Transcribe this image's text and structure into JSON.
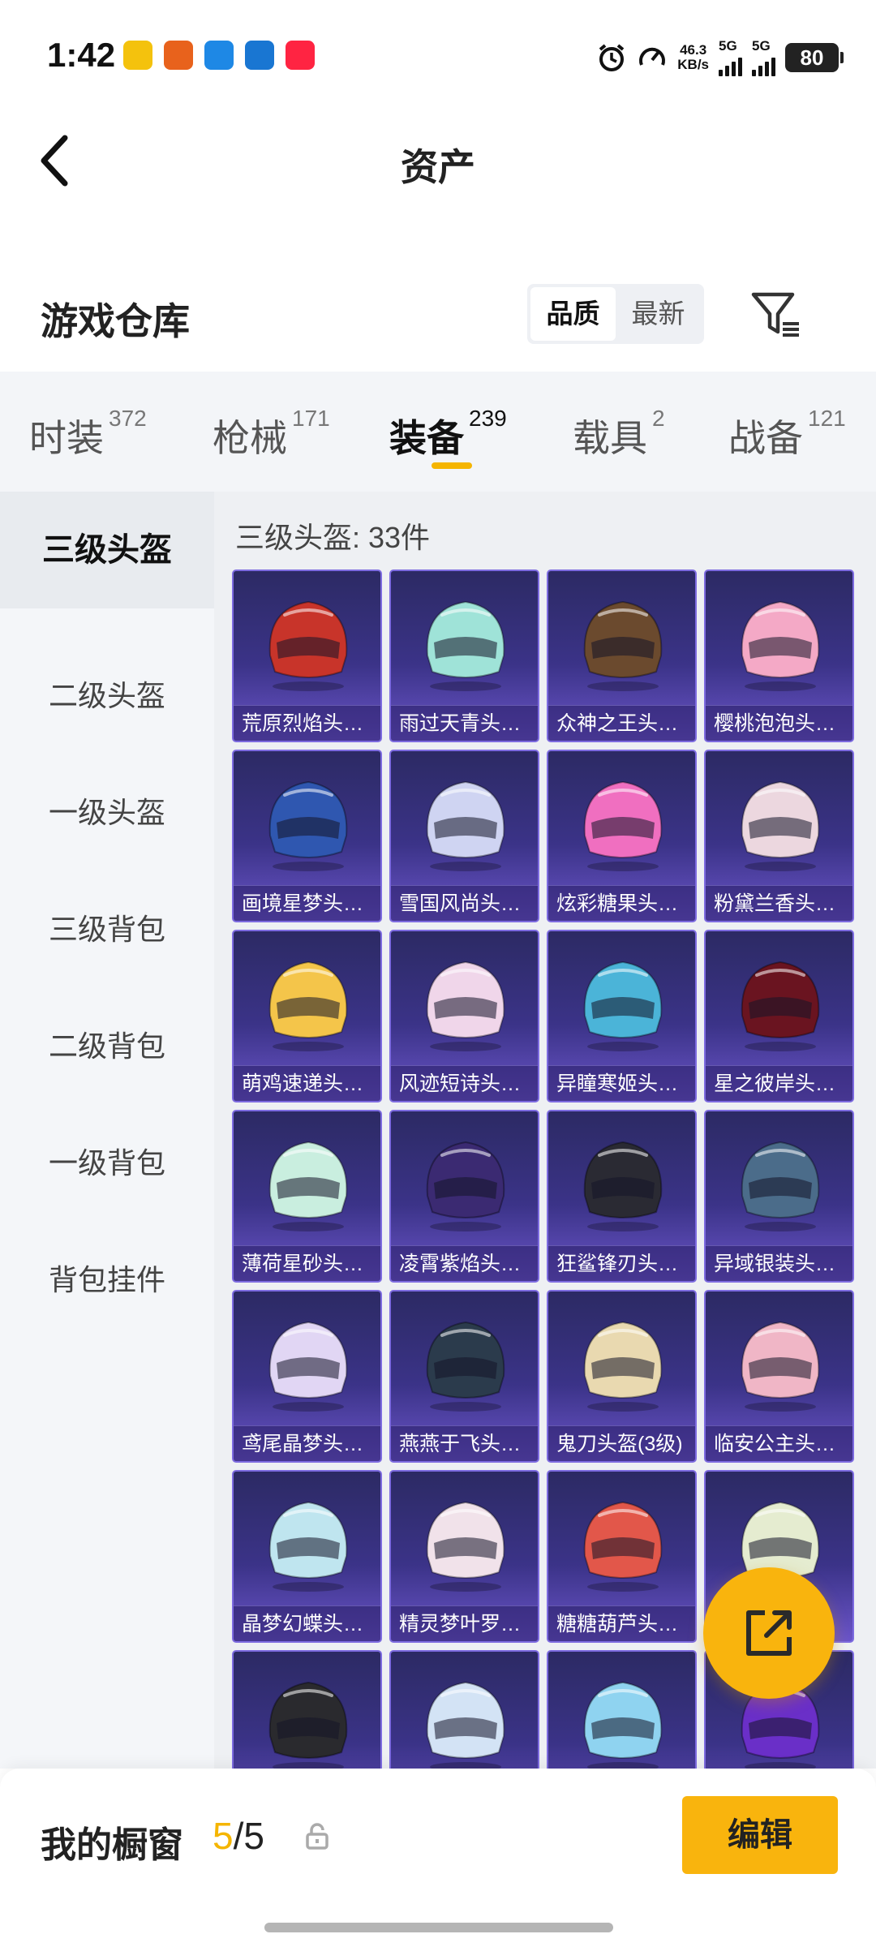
{
  "status_bar": {
    "time": "1:42",
    "net_speed_value": "46.3",
    "net_speed_unit": "KB/s",
    "network_1": "5G",
    "network_2": "5G",
    "battery": "80",
    "app_icons": [
      {
        "icon": "rabbit-app-icon",
        "color": "#f4c20d"
      },
      {
        "icon": "pumpkin-app-icon",
        "color": "#e8621c"
      },
      {
        "icon": "browser-app-icon",
        "color": "#1e88e5"
      },
      {
        "icon": "message-app-icon",
        "color": "#1976d2"
      },
      {
        "icon": "xiaohongshu-app-icon",
        "color": "#ff2442"
      }
    ]
  },
  "header": {
    "title": "资产"
  },
  "warehouse": {
    "title": "游戏仓库",
    "sort_options": [
      "品质",
      "最新"
    ],
    "active_sort": "品质"
  },
  "tabs": [
    {
      "label": "时装",
      "count": "372"
    },
    {
      "label": "枪械",
      "count": "171"
    },
    {
      "label": "装备",
      "count": "239"
    },
    {
      "label": "载具",
      "count": "2"
    },
    {
      "label": "战备",
      "count": "121"
    }
  ],
  "active_tab": "装备",
  "sidebar": {
    "items": [
      "三级头盔",
      "二级头盔",
      "一级头盔",
      "三级背包",
      "二级背包",
      "一级背包",
      "背包挂件"
    ],
    "active": "三级头盔"
  },
  "content": {
    "count_label": "三级头盔: 33件",
    "items": [
      {
        "name": "荒原烈焰头…",
        "color": "#c8342a"
      },
      {
        "name": "雨过天青头…",
        "color": "#9fe3d8"
      },
      {
        "name": "众神之王头…",
        "color": "#6b4a2e"
      },
      {
        "name": "樱桃泡泡头…",
        "color": "#f4a9c6"
      },
      {
        "name": "画境星梦头…",
        "color": "#2f57b0"
      },
      {
        "name": "雪国风尚头…",
        "color": "#cfd4f2"
      },
      {
        "name": "炫彩糖果头…",
        "color": "#f06fc0"
      },
      {
        "name": "粉黛兰香头…",
        "color": "#ecd7df"
      },
      {
        "name": "萌鸡速递头…",
        "color": "#f4c54a"
      },
      {
        "name": "风迹短诗头…",
        "color": "#f0d6ea"
      },
      {
        "name": "异瞳寒姬头…",
        "color": "#4bb4d8"
      },
      {
        "name": "星之彼岸头…",
        "color": "#6a1420"
      },
      {
        "name": "薄荷星砂头…",
        "color": "#c9eedf"
      },
      {
        "name": "凌霄紫焰头…",
        "color": "#3b2a72"
      },
      {
        "name": "狂鲨锋刃头…",
        "color": "#2a2a33"
      },
      {
        "name": "异域银装头…",
        "color": "#4b6c8a"
      },
      {
        "name": "鸢尾晶梦头…",
        "color": "#e1d6f4"
      },
      {
        "name": "燕燕于飞头…",
        "color": "#2b3b4c"
      },
      {
        "name": "鬼刀头盔(3级)",
        "color": "#e9d9b0"
      },
      {
        "name": "临安公主头…",
        "color": "#f0b6c6"
      },
      {
        "name": "晶梦幻蝶头…",
        "color": "#bfe5ef"
      },
      {
        "name": "精灵梦叶罗…",
        "color": "#f1e2ea"
      },
      {
        "name": "糖糖葫芦头…",
        "color": "#e2574a"
      },
      {
        "name": "",
        "color": "#e5ecd0"
      },
      {
        "name": "",
        "color": "#2a2a2e"
      },
      {
        "name": "",
        "color": "#d3e3f5"
      },
      {
        "name": "",
        "color": "#8fd3f0"
      },
      {
        "name": "",
        "color": "#6a2fc8"
      }
    ]
  },
  "showcase": {
    "label": "我的橱窗",
    "current": "5",
    "separator": "/",
    "total": "5",
    "edit_label": "编辑"
  }
}
